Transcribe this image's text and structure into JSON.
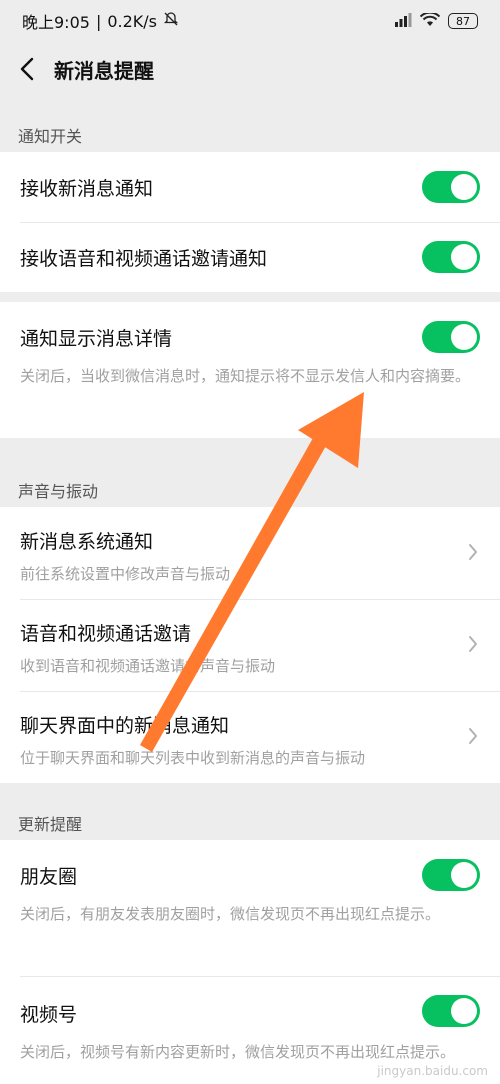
{
  "status_bar": {
    "time": "晚上9:05",
    "speed": "0.2K/s",
    "battery": "87",
    "icons": [
      "mute-icon",
      "signal-icon",
      "wifi-icon",
      "battery-icon"
    ]
  },
  "navbar": {
    "title": "新消息提醒",
    "back_icon": "chevron-left-icon"
  },
  "sections": {
    "notify": {
      "label": "通知开关",
      "items": [
        {
          "title": "接收新消息通知",
          "on": true
        },
        {
          "title": "接收语音和视频通话邀请通知",
          "on": true
        }
      ]
    },
    "details": {
      "title": "通知显示消息详情",
      "on": true,
      "desc": "关闭后，当收到微信消息时，通知提示将不显示发信人和内容摘要。"
    },
    "sound": {
      "label": "声音与振动",
      "items": [
        {
          "title": "新消息系统通知",
          "sub": "前往系统设置中修改声音与振动"
        },
        {
          "title": "语音和视频通话邀请",
          "sub": "收到语音和视频通话邀请的声音与振动"
        },
        {
          "title": "聊天界面中的新消息通知",
          "sub": "位于聊天界面和聊天列表中收到新消息的声音与振动"
        }
      ]
    },
    "update": {
      "label": "更新提醒",
      "items": [
        {
          "title": "朋友圈",
          "on": true,
          "desc": "关闭后，有朋友发表朋友圈时，微信发现页不再出现红点提示。"
        },
        {
          "title": "视频号",
          "on": true,
          "desc": "关闭后，视频号有新内容更新时，微信发现页不再出现红点提示。"
        }
      ]
    }
  },
  "colors": {
    "toggle_on": "#07c160",
    "arrow": "#ff7a2f",
    "page_bg": "#ededed"
  },
  "watermark": "jingyan.baidu.com"
}
